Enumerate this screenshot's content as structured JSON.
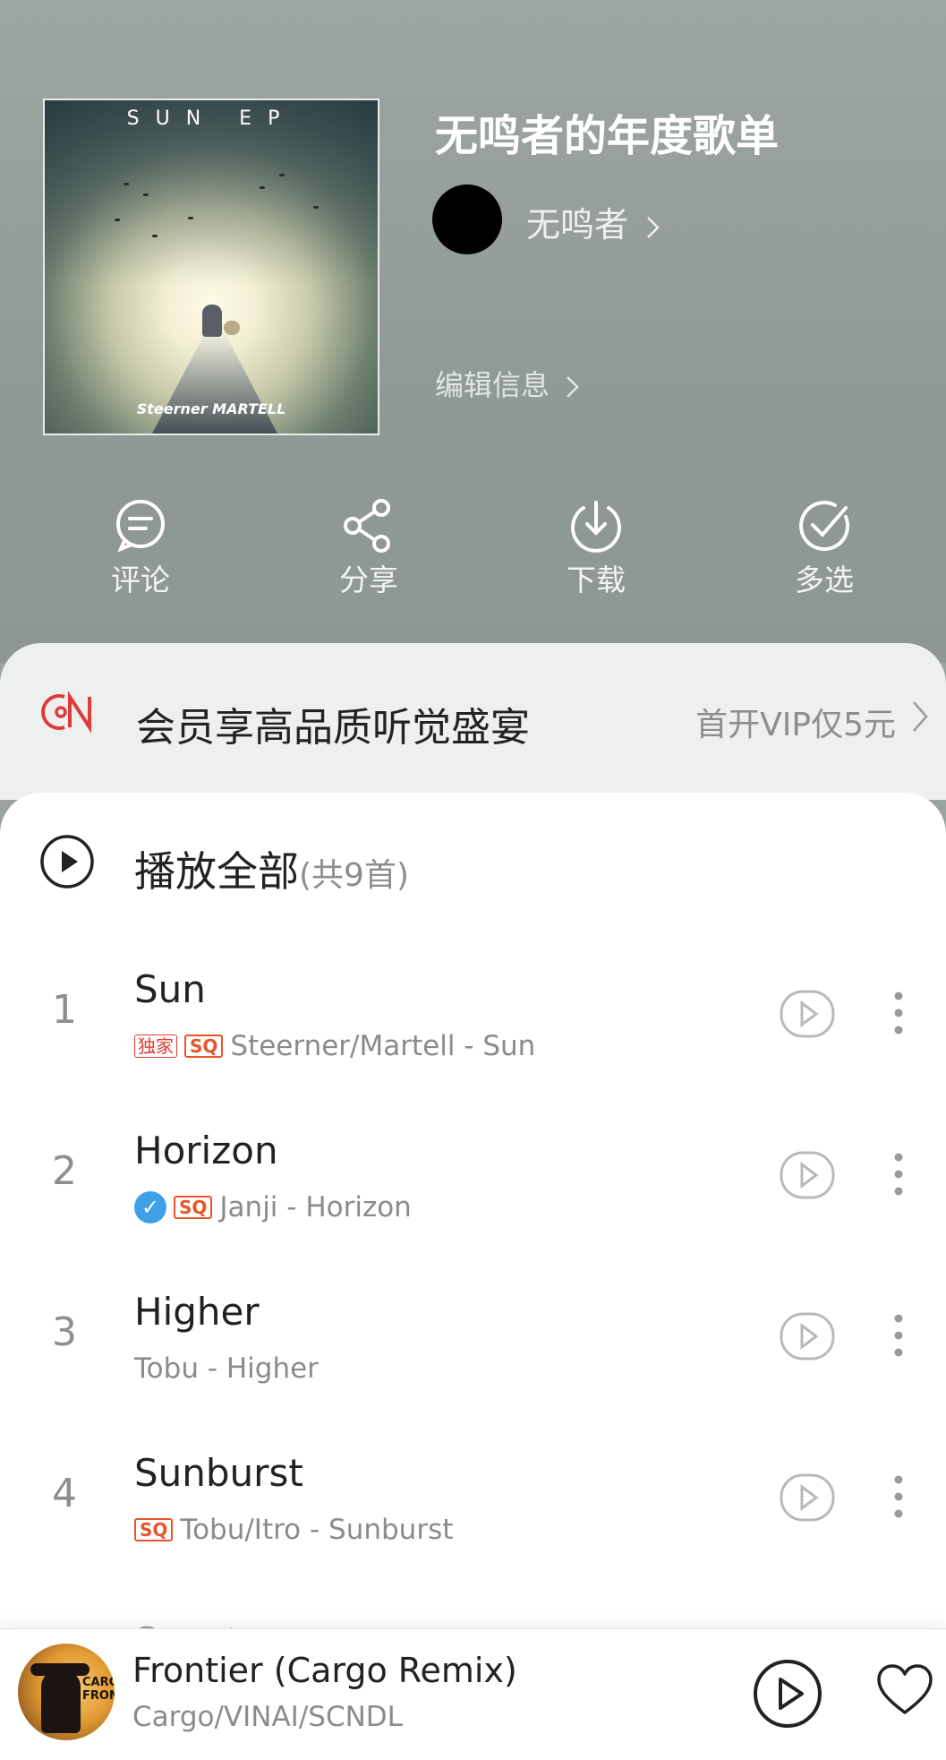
{
  "playlist": {
    "cover_title": "SUN EP",
    "cover_logo": "Steerner MARTELL",
    "title": "无鸣者的年度歌单",
    "creator": "无鸣者",
    "edit_label": "编辑信息"
  },
  "actions": [
    {
      "label": "评论",
      "icon": "comment-icon"
    },
    {
      "label": "分享",
      "icon": "share-icon"
    },
    {
      "label": "下载",
      "icon": "download-icon"
    },
    {
      "label": "多选",
      "icon": "multi-select-icon"
    }
  ],
  "vip": {
    "text": "会员享高品质听觉盛宴",
    "link": "首开VIP仅5元"
  },
  "play_all": {
    "label": "播放全部",
    "count": "(共9首)"
  },
  "tracks": [
    {
      "num": "1",
      "title": "Sun",
      "badges": [
        "独家",
        "SQ"
      ],
      "subtitle": "Steerner/Martell - Sun"
    },
    {
      "num": "2",
      "title": "Horizon",
      "badges": [
        "verified",
        "SQ"
      ],
      "subtitle": "Janji - Horizon"
    },
    {
      "num": "3",
      "title": "Higher",
      "badges": [],
      "subtitle": "Tobu - Higher"
    },
    {
      "num": "4",
      "title": "Sunburst",
      "badges": [
        "SQ"
      ],
      "subtitle": "Tobu/Itro - Sunburst"
    }
  ],
  "partial_track": {
    "title": "Spectre"
  },
  "badges": {
    "exclusive": "独家",
    "sq": "SQ",
    "verified": "✓"
  },
  "now_playing": {
    "title": "Frontier (Cargo Remix)",
    "artist": "Cargo/VINAI/SCNDL",
    "cover_text": "CARGO FRONTIER"
  },
  "colors": {
    "header_bg": "#959e9a",
    "vip_red": "#e03a3a",
    "sq_orange": "#e8552b",
    "verified_blue": "#3fa0e8"
  }
}
